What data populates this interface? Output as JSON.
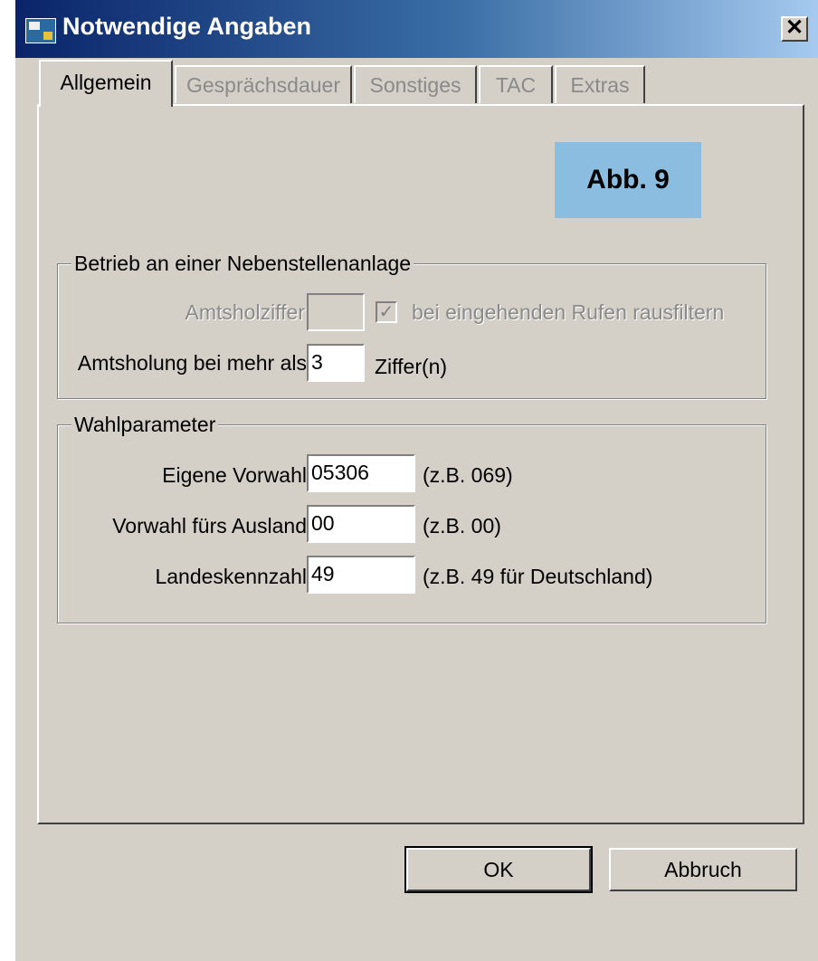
{
  "window": {
    "title": "Notwendige Angaben",
    "close_glyph": "✕",
    "icon": "app-icon"
  },
  "tabs": [
    {
      "label": "Allgemein",
      "active": true
    },
    {
      "label": "Gesprächsdauer",
      "active": false
    },
    {
      "label": "Sonstiges",
      "active": false
    },
    {
      "label": "TAC",
      "active": false
    },
    {
      "label": "Extras",
      "active": false
    }
  ],
  "annotation": {
    "label": "Abb. 9",
    "color": "#8bbde0"
  },
  "group_nebenstellen": {
    "legend": "Betrieb an einer Nebenstellenanlage",
    "amtsholziffer_label": "Amtsholziffer",
    "amtsholziffer_value": "",
    "checkbox_label": "bei eingehenden Rufen rausfiltern",
    "checkbox_checked": true,
    "amtsholung_label": "Amtsholung bei mehr als",
    "amtsholung_value": "3",
    "amtsholung_suffix": "Ziffer(n)"
  },
  "group_wahlparameter": {
    "legend": "Wahlparameter",
    "rows": [
      {
        "label": "Eigene Vorwahl",
        "value": "05306",
        "hint": "(z.B. 069)"
      },
      {
        "label": "Vorwahl fürs Ausland",
        "value": "00",
        "hint": "(z.B. 00)"
      },
      {
        "label": "Landeskennzahl",
        "value": "49",
        "hint": "(z.B. 49 für Deutschland)"
      }
    ]
  },
  "buttons": {
    "ok": "OK",
    "cancel": "Abbruch"
  },
  "colors": {
    "titlebar_start": "#0a246a",
    "titlebar_end": "#a6caf0",
    "face": "#d4d0c8"
  }
}
